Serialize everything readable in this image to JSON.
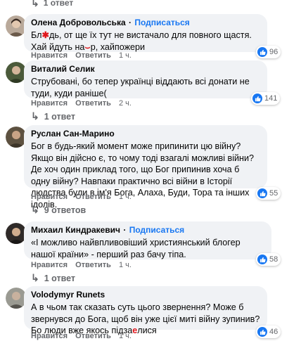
{
  "top_replies": {
    "label": "1 ответ"
  },
  "comments": [
    {
      "name": "Олена Добровольська",
      "subscribe": "Подписаться",
      "text_parts": [
        "Бл",
        "дь, от ще їх тут не вистачало для повного щастя. Хай йдуть на",
        "р, хайпожери"
      ],
      "like_label": "Нравится",
      "reply_label": "Ответить",
      "time": "1 ч.",
      "reactions": "96"
    },
    {
      "name": "Виталий Селик",
      "text": "Струбовані, бо тепер українці віддають всі донати не туди, куди раніше(",
      "like_label": "Нравится",
      "reply_label": "Ответить",
      "time": "2 ч.",
      "reactions": "141",
      "replies": "1 ответ"
    },
    {
      "name": "Руслан Сан-Марино",
      "text": "Бог в будь-який момент може припинити цю війну? Якщо він дійсно є, то чому тоді взагалі можливі війни? Де хоч один приклад того, що Бог припинив хоча б одну війну? Навпаки практично всі війни в Історії людства були в ім'я Бога, Алаха, Буди, Тора та інших ідолів.",
      "like_label": "Нравится",
      "reply_label": "Ответить",
      "time": "1 ч.",
      "reactions": "55",
      "replies": "9 ответов"
    },
    {
      "name": "Михаил Киндракевич",
      "subscribe": "Подписаться",
      "text": "«І можливо найвпливовіший християнський блогер нашої країни» - перший раз бачу тіпа.",
      "like_label": "Нравится",
      "reply_label": "Ответить",
      "time": "1 ч.",
      "reactions": "58",
      "replies": "1 ответ"
    },
    {
      "name": "Volodymyr Runets",
      "text_parts": [
        "А в чьом так сказать суть цього звернення? Може б звернувся до Бога, щоб він уже цієї миті війну зупинив? Бо люди вже якось підза",
        "е",
        "лися"
      ],
      "like_label": "Нравится",
      "reply_label": "Ответить",
      "time": "1 ч.",
      "reactions": "46"
    }
  ],
  "colors": {
    "link": "#1877f2",
    "bubble": "#f0f2f5",
    "muted": "#65676b",
    "censor": "#e0161b"
  },
  "icons": {
    "like": "thumbs-up-icon",
    "reply_arrow": "reply-arrow-icon"
  }
}
